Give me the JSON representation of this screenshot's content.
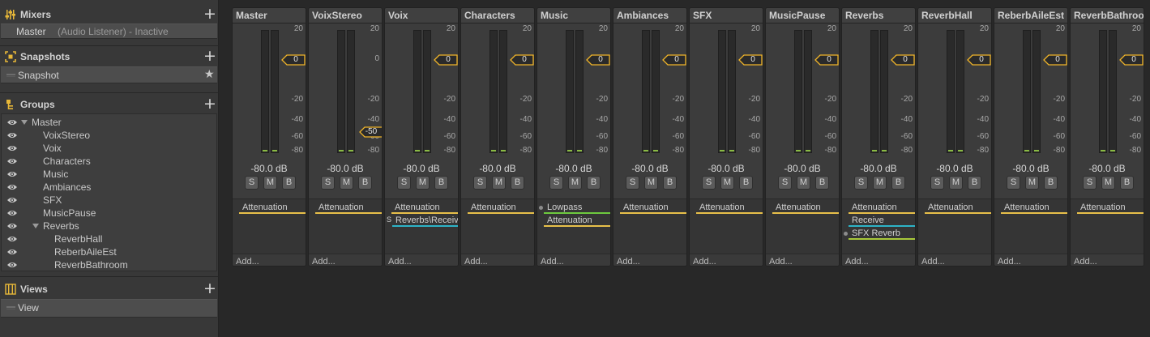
{
  "sidebar": {
    "mixers": {
      "title": "Mixers",
      "items": [
        {
          "name": "Master",
          "detail": "(Audio Listener) - Inactive"
        }
      ]
    },
    "snapshots": {
      "title": "Snapshots",
      "items": [
        {
          "name": "Snapshot",
          "starred": true
        }
      ]
    },
    "groups": {
      "title": "Groups",
      "items": [
        {
          "name": "Master",
          "indent": 0,
          "expanded": true
        },
        {
          "name": "VoixStereo",
          "indent": 1
        },
        {
          "name": "Voix",
          "indent": 1
        },
        {
          "name": "Characters",
          "indent": 1
        },
        {
          "name": "Music",
          "indent": 1
        },
        {
          "name": "Ambiances",
          "indent": 1
        },
        {
          "name": "SFX",
          "indent": 1
        },
        {
          "name": "MusicPause",
          "indent": 1
        },
        {
          "name": "Reverbs",
          "indent": 1,
          "expanded": true
        },
        {
          "name": "ReverbHall",
          "indent": 2
        },
        {
          "name": "ReberbAileEst",
          "indent": 2
        },
        {
          "name": "ReverbBathroom",
          "indent": 2
        }
      ]
    },
    "views": {
      "title": "Views",
      "items": [
        {
          "name": "View"
        }
      ]
    }
  },
  "strip_common": {
    "scale_ticks": [
      "20",
      "0",
      "-20",
      "-40",
      "-60",
      "-80"
    ],
    "level_label": "-80.0 dB",
    "buttons": [
      "S",
      "M",
      "B"
    ],
    "add_label": "Add..."
  },
  "strips": [
    {
      "name": "Master",
      "fader": "0",
      "effects": [
        {
          "name": "Attenuation",
          "color": "#e8c04a"
        }
      ]
    },
    {
      "name": "VoixStereo",
      "fader": "-50",
      "effects": [
        {
          "name": "Attenuation",
          "color": "#e8c04a"
        }
      ]
    },
    {
      "name": "Voix",
      "fader": "0",
      "effects": [
        {
          "name": "Attenuation",
          "color": "#e8c04a"
        },
        {
          "name": "Reverbs\\Receive",
          "color": "#2db3c7",
          "prefix": "S"
        }
      ]
    },
    {
      "name": "Characters",
      "fader": "0",
      "effects": [
        {
          "name": "Attenuation",
          "color": "#e8c04a"
        }
      ]
    },
    {
      "name": "Music",
      "fader": "0",
      "effects": [
        {
          "name": "Lowpass",
          "color": "#6ec93e",
          "dot": true
        },
        {
          "name": "Attenuation",
          "color": "#e8c04a"
        }
      ]
    },
    {
      "name": "Ambiances",
      "fader": "0",
      "effects": [
        {
          "name": "Attenuation",
          "color": "#e8c04a"
        }
      ]
    },
    {
      "name": "SFX",
      "fader": "0",
      "effects": [
        {
          "name": "Attenuation",
          "color": "#e8c04a"
        }
      ]
    },
    {
      "name": "MusicPause",
      "fader": "0",
      "effects": [
        {
          "name": "Attenuation",
          "color": "#e8c04a"
        }
      ]
    },
    {
      "name": "Reverbs",
      "fader": "0",
      "effects": [
        {
          "name": "Attenuation",
          "color": "#e8c04a"
        },
        {
          "name": "Receive",
          "color": "#2db3c7"
        },
        {
          "name": "SFX Reverb",
          "color": "#a8c83a",
          "dot": true
        }
      ]
    },
    {
      "name": "ReverbHall",
      "fader": "0",
      "effects": [
        {
          "name": "Attenuation",
          "color": "#e8c04a"
        }
      ]
    },
    {
      "name": "ReberbAileEst",
      "fader": "0",
      "effects": [
        {
          "name": "Attenuation",
          "color": "#e8c04a"
        }
      ]
    },
    {
      "name": "ReverbBathroom",
      "fader": "0",
      "effects": [
        {
          "name": "Attenuation",
          "color": "#e8c04a"
        }
      ]
    }
  ],
  "colors": {
    "accent": "#f0b429",
    "meter_led": "#8aba44"
  }
}
